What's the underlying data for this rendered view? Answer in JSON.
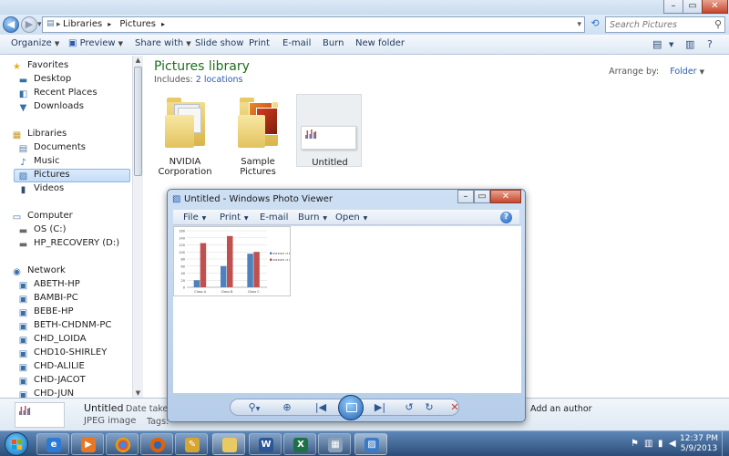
{
  "explorer": {
    "address": {
      "crumbs": [
        "Libraries",
        "Pictures"
      ]
    },
    "search": {
      "placeholder": "Search Pictures"
    },
    "toolbar": {
      "organize": "Organize",
      "preview": "Preview",
      "share_with": "Share with",
      "slide_show": "Slide show",
      "print": "Print",
      "email": "E-mail",
      "burn": "Burn",
      "new_folder": "New folder"
    },
    "nav": {
      "favorites": {
        "label": "Favorites",
        "items": [
          "Desktop",
          "Recent Places",
          "Downloads"
        ]
      },
      "libraries": {
        "label": "Libraries",
        "items": [
          "Documents",
          "Music",
          "Pictures",
          "Videos"
        ],
        "selected": "Pictures"
      },
      "computer": {
        "label": "Computer",
        "items": [
          "OS (C:)",
          "HP_RECOVERY (D:)"
        ]
      },
      "network": {
        "label": "Network",
        "items": [
          "ABETH-HP",
          "BAMBI-PC",
          "BEBE-HP",
          "BETH-CHDNM-PC",
          "CHD_LOIDA",
          "CHD10-SHIRLEY",
          "CHD-ALILIE",
          "CHD-JACOT",
          "CHD-JUN"
        ]
      }
    },
    "content": {
      "title": "Pictures library",
      "includes_label": "Includes:",
      "includes_link": "2 locations",
      "arrange_label": "Arrange by:",
      "arrange_value": "Folder",
      "items": [
        {
          "line1": "NVIDIA",
          "line2": "Corporation"
        },
        {
          "line1": "Sample Pictures",
          "line2": ""
        },
        {
          "line1": "Untitled",
          "line2": ""
        }
      ]
    },
    "details": {
      "name": "Untitled",
      "type": "JPEG image",
      "date_taken_label": "Date taken:",
      "tags_label": "Tags:",
      "authors_placeholder": "Add an author"
    }
  },
  "photo_viewer": {
    "title": "Untitled - Windows Photo Viewer",
    "menu": {
      "file": "File",
      "print": "Print",
      "email": "E-mail",
      "burn": "Burn",
      "open": "Open"
    },
    "help": "?"
  },
  "chart_data": {
    "type": "bar",
    "categories": [
      "Class A",
      "Class B",
      "Class C"
    ],
    "series": [
      {
        "name": "##### of Boys",
        "values": [
          20,
          60,
          95
        ]
      },
      {
        "name": "##### of Girls",
        "values": [
          125,
          145,
          100
        ]
      }
    ],
    "ylim": [
      0,
      160
    ],
    "yticks": [
      0,
      20,
      40,
      60,
      80,
      100,
      120,
      140,
      160
    ],
    "colors": [
      "#4f81bd",
      "#c0504d"
    ],
    "legend": "right"
  },
  "taskbar": {
    "time": "12:37 PM",
    "date": "5/9/2013"
  },
  "colors": {
    "library_title": "#1e6e1e",
    "link": "#2a5db0"
  }
}
